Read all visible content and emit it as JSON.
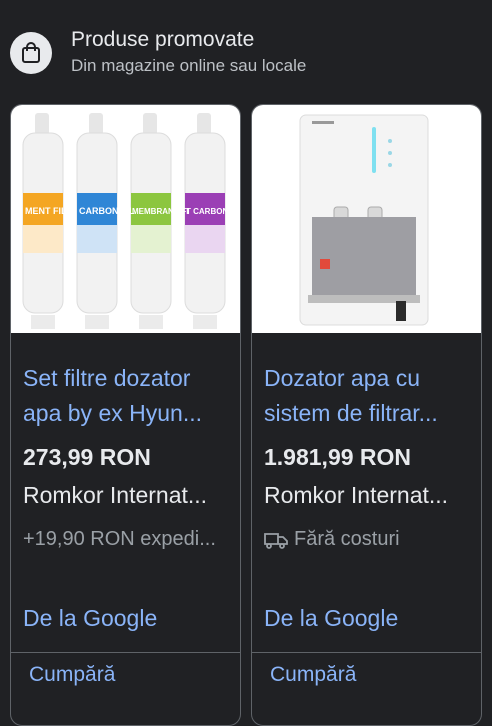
{
  "header": {
    "title": "Produse promovate",
    "subtitle": "Din magazine online sau locale",
    "icon": "shopping-bag-icon"
  },
  "products": [
    {
      "title_line1": "Set filtre dozator",
      "title_line2": "apa by ex Hyun...",
      "price": "273,99 RON",
      "store": "Romkor Internat...",
      "shipping": "+19,90 RON expedi...",
      "source": "De la Google",
      "buy_label": "Cumpără",
      "filter_labels": [
        "MENT FILT",
        "CARBON FIL",
        "MEMBRANE FI",
        "T CARBON FI"
      ]
    },
    {
      "title_line1": "Dozator apa cu",
      "title_line2": "sistem de filtrar...",
      "price": "1.981,99 RON",
      "store": "Romkor Internat...",
      "shipping": "Fără costuri",
      "shipping_icon": "truck-icon",
      "source": "De la Google",
      "buy_label": "Cumpără"
    }
  ],
  "colors": {
    "background": "#202124",
    "link": "#8ab4f8",
    "text": "#e8eaed",
    "muted": "#9aa0a6",
    "border": "#5f6368"
  }
}
